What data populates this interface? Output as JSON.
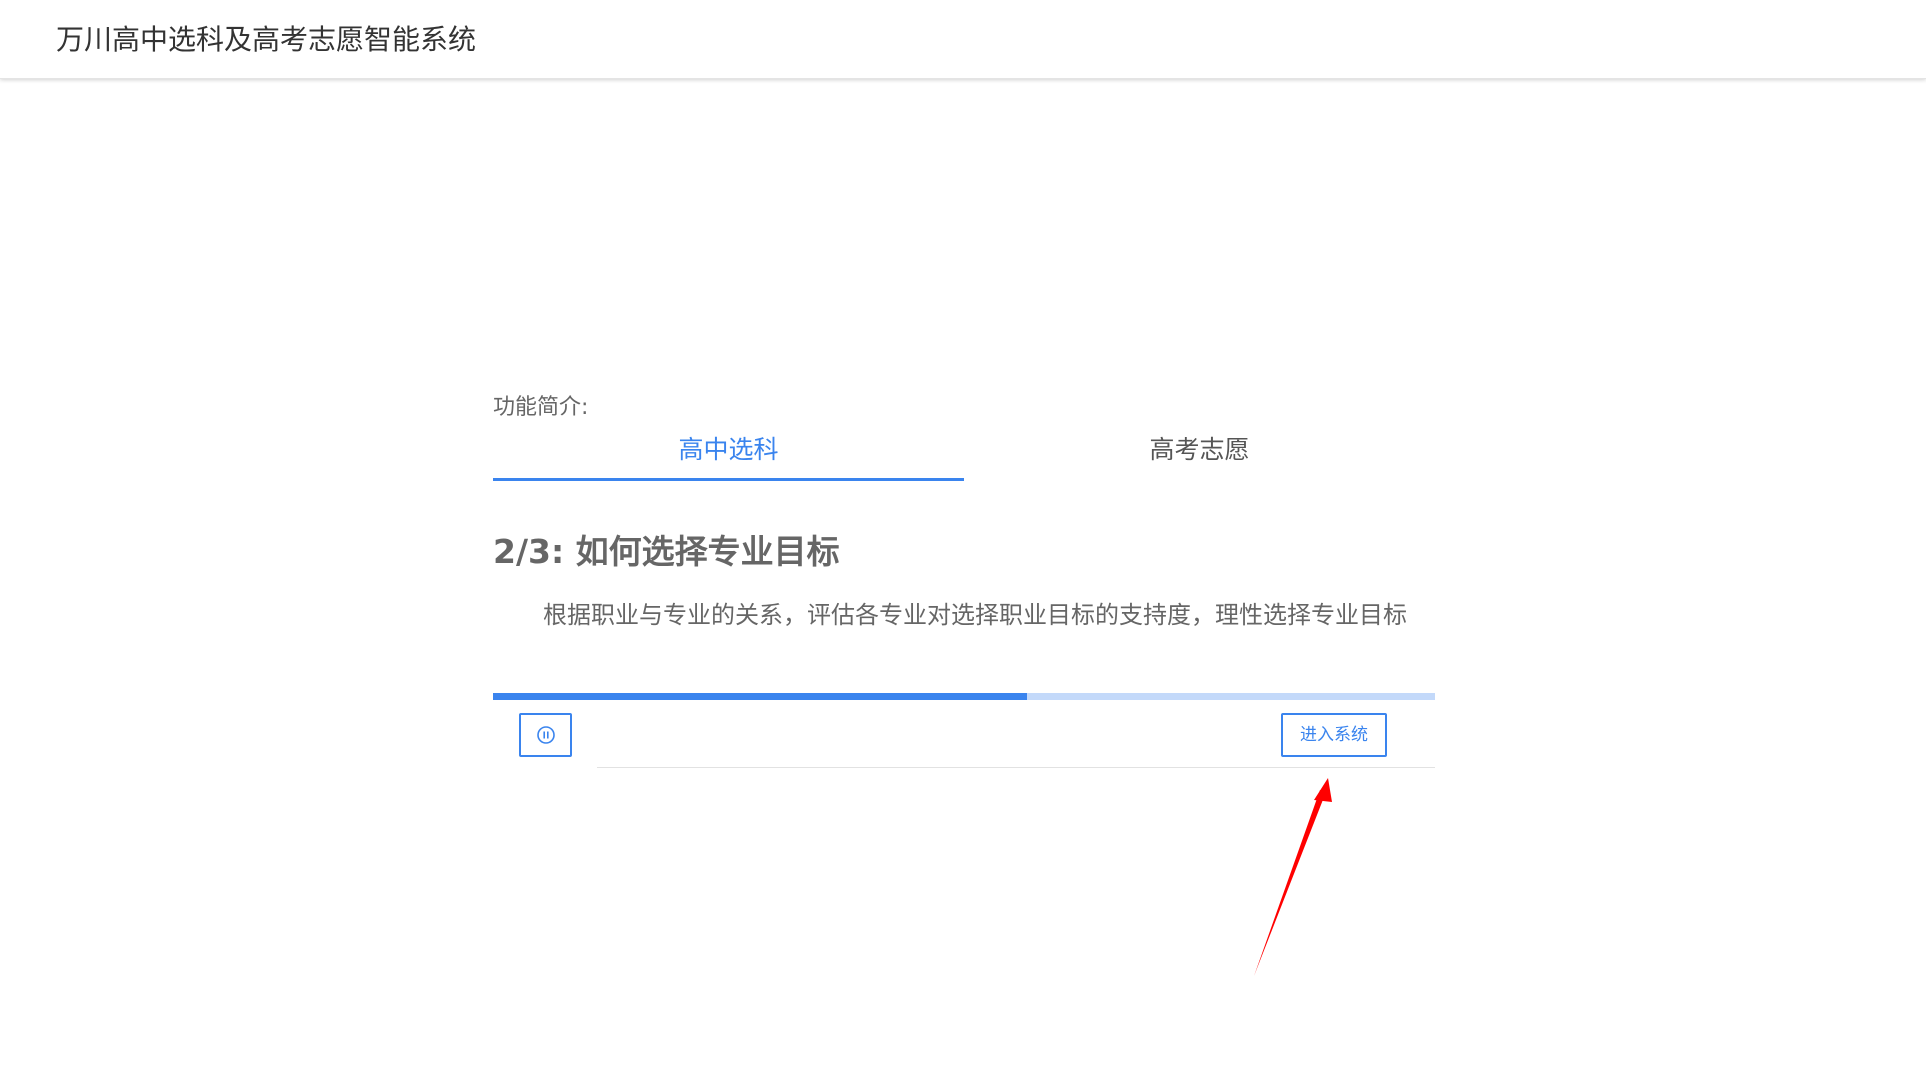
{
  "header": {
    "app_title": "万川高中选科及高考志愿智能系统"
  },
  "intro": {
    "label": "功能简介:"
  },
  "tabs": [
    {
      "label": "高中选科",
      "active": true
    },
    {
      "label": "高考志愿",
      "active": false
    }
  ],
  "step": {
    "title": "2/3: 如何选择专业目标",
    "description": "根据职业与专业的关系，评估各专业对选择职业目标的支持度，理性选择专业目标"
  },
  "progress": {
    "fraction": 0.567
  },
  "controls": {
    "pause_icon": "pause-circle-icon",
    "enter_label": "进入系统"
  },
  "colors": {
    "accent": "#3a84ee",
    "progress_track": "#c3d9fa",
    "annotation": "#ff0000"
  }
}
